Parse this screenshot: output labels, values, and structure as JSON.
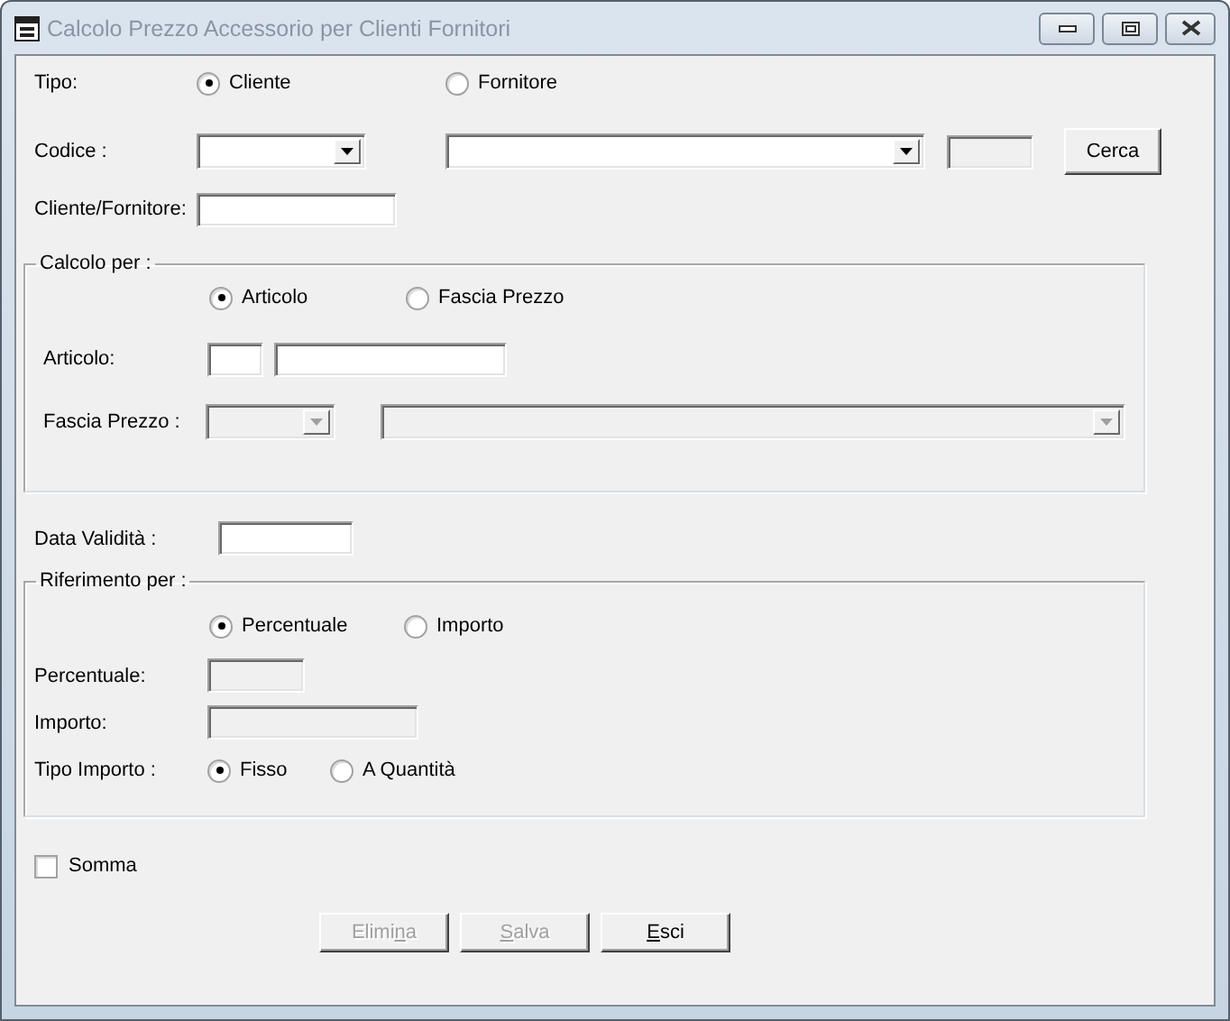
{
  "window": {
    "title": "Calcolo Prezzo Accessorio per Clienti Fornitori"
  },
  "tipo": {
    "label": "Tipo:",
    "options": [
      {
        "label": "Cliente",
        "selected": true
      },
      {
        "label": "Fornitore",
        "selected": false
      }
    ]
  },
  "codice": {
    "label": "Codice :",
    "fields": [
      {
        "kind": "combo",
        "disabled": false
      },
      {
        "kind": "combo",
        "disabled": false
      },
      {
        "kind": "text",
        "disabled": true
      }
    ],
    "button": {
      "label": "Cerca"
    }
  },
  "cliente_fornitore": {
    "label": "Cliente/Fornitore:",
    "fields": [
      {
        "kind": "text",
        "disabled": false
      }
    ]
  },
  "calcolo_per": {
    "legend": "Calcolo per :",
    "options": [
      {
        "label": "Articolo",
        "selected": true
      },
      {
        "label": "Fascia Prezzo",
        "selected": false
      }
    ],
    "articolo": {
      "label": "Articolo:",
      "fields": [
        {
          "kind": "text",
          "disabled": false
        },
        {
          "kind": "text",
          "disabled": false
        }
      ]
    },
    "fascia_prezzo": {
      "label": "Fascia Prezzo :",
      "fields": [
        {
          "kind": "combo",
          "disabled": true
        },
        {
          "kind": "combo",
          "disabled": true
        }
      ]
    }
  },
  "data_validita": {
    "label": "Data Validità :",
    "fields": [
      {
        "kind": "text",
        "disabled": false
      }
    ]
  },
  "riferimento_per": {
    "legend": "Riferimento per :",
    "options": [
      {
        "label": "Percentuale",
        "selected": true
      },
      {
        "label": "Importo",
        "selected": false
      }
    ],
    "percentuale": {
      "label": "Percentuale:",
      "fields": [
        {
          "kind": "text",
          "disabled": true
        }
      ]
    },
    "importo": {
      "label": "Importo:",
      "fields": [
        {
          "kind": "text",
          "disabled": true
        }
      ]
    },
    "tipo_importo": {
      "label": "Tipo Importo :",
      "options": [
        {
          "label": "Fisso",
          "selected": true
        },
        {
          "label": "A Quantità",
          "selected": false
        }
      ]
    }
  },
  "somma": {
    "label": "Somma",
    "checked": false
  },
  "buttons": [
    {
      "before": "Elimi",
      "key": "n",
      "after": "a",
      "disabled": true
    },
    {
      "key": "S",
      "after": "alva",
      "disabled": true
    },
    {
      "key": "E",
      "after": "sci",
      "disabled": false
    }
  ]
}
